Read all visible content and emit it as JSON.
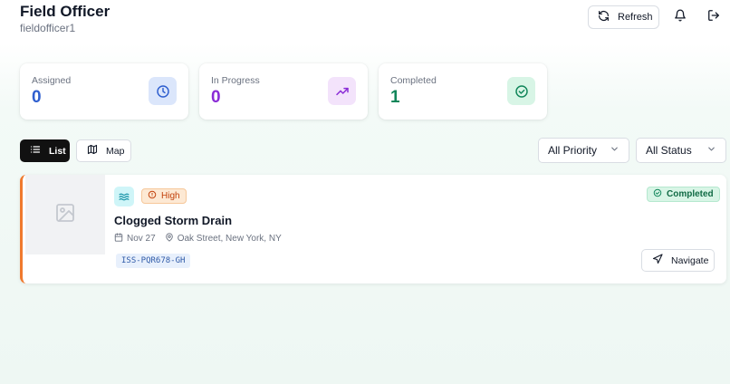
{
  "header": {
    "title": "Field Officer",
    "username": "fieldofficer1",
    "refresh_label": "Refresh"
  },
  "stats": [
    {
      "label": "Assigned",
      "value": "0",
      "color": "#2f5fcf",
      "icon": "clock-icon",
      "icon_bg": "#dbe6fb"
    },
    {
      "label": "In Progress",
      "value": "0",
      "color": "#8a2bd6",
      "icon": "trending-up-icon",
      "icon_bg": "#f3e3fb"
    },
    {
      "label": "Completed",
      "value": "1",
      "color": "#11865a",
      "icon": "check-circle-icon",
      "icon_bg": "#d8f5e6"
    }
  ],
  "views": {
    "list_label": "List",
    "map_label": "Map",
    "active": "List"
  },
  "filters": {
    "priority_selected": "All Priority",
    "status_selected": "All Status"
  },
  "issues": [
    {
      "category_icon": "waves-icon",
      "priority": "High",
      "title": "Clogged Storm Drain",
      "date": "Nov 27",
      "location": "Oak Street, New York, NY",
      "id": "ISS-PQR678-GH",
      "status": "Completed",
      "navigate_label": "Navigate",
      "accent_color": "#f07a2e"
    }
  ]
}
